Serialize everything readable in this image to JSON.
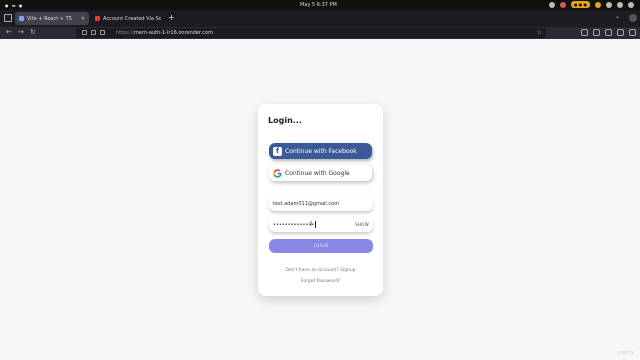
{
  "os": {
    "clock": "May 5   6:37 PM",
    "status_pill": "● ● ●"
  },
  "browser": {
    "tabs": [
      {
        "label": "Vite + React + TS",
        "active": true
      },
      {
        "label": "Account Created Via Soc",
        "active": false
      }
    ],
    "new_tab": "+",
    "url_scheme": "https://",
    "url_host": "mern-auth-1-lr16.onrender.com",
    "back": "←",
    "forward": "→",
    "reload": "↻",
    "star": "☆"
  },
  "login": {
    "title": "Login...",
    "facebook_label": "Continue with Facebook",
    "google_label": "Continue with Google",
    "email_value": "test.adam011@gmail.com",
    "password_value": "••••••••••••••",
    "show_label": "SHOW",
    "login_label": "LOGIN",
    "signup_text": "Don't have an account? Signup",
    "forgot_text": "Forgot Password?"
  },
  "watermark": "udemy",
  "colors": {
    "facebook": "#3b5998",
    "login_button": "#8b87e6"
  }
}
